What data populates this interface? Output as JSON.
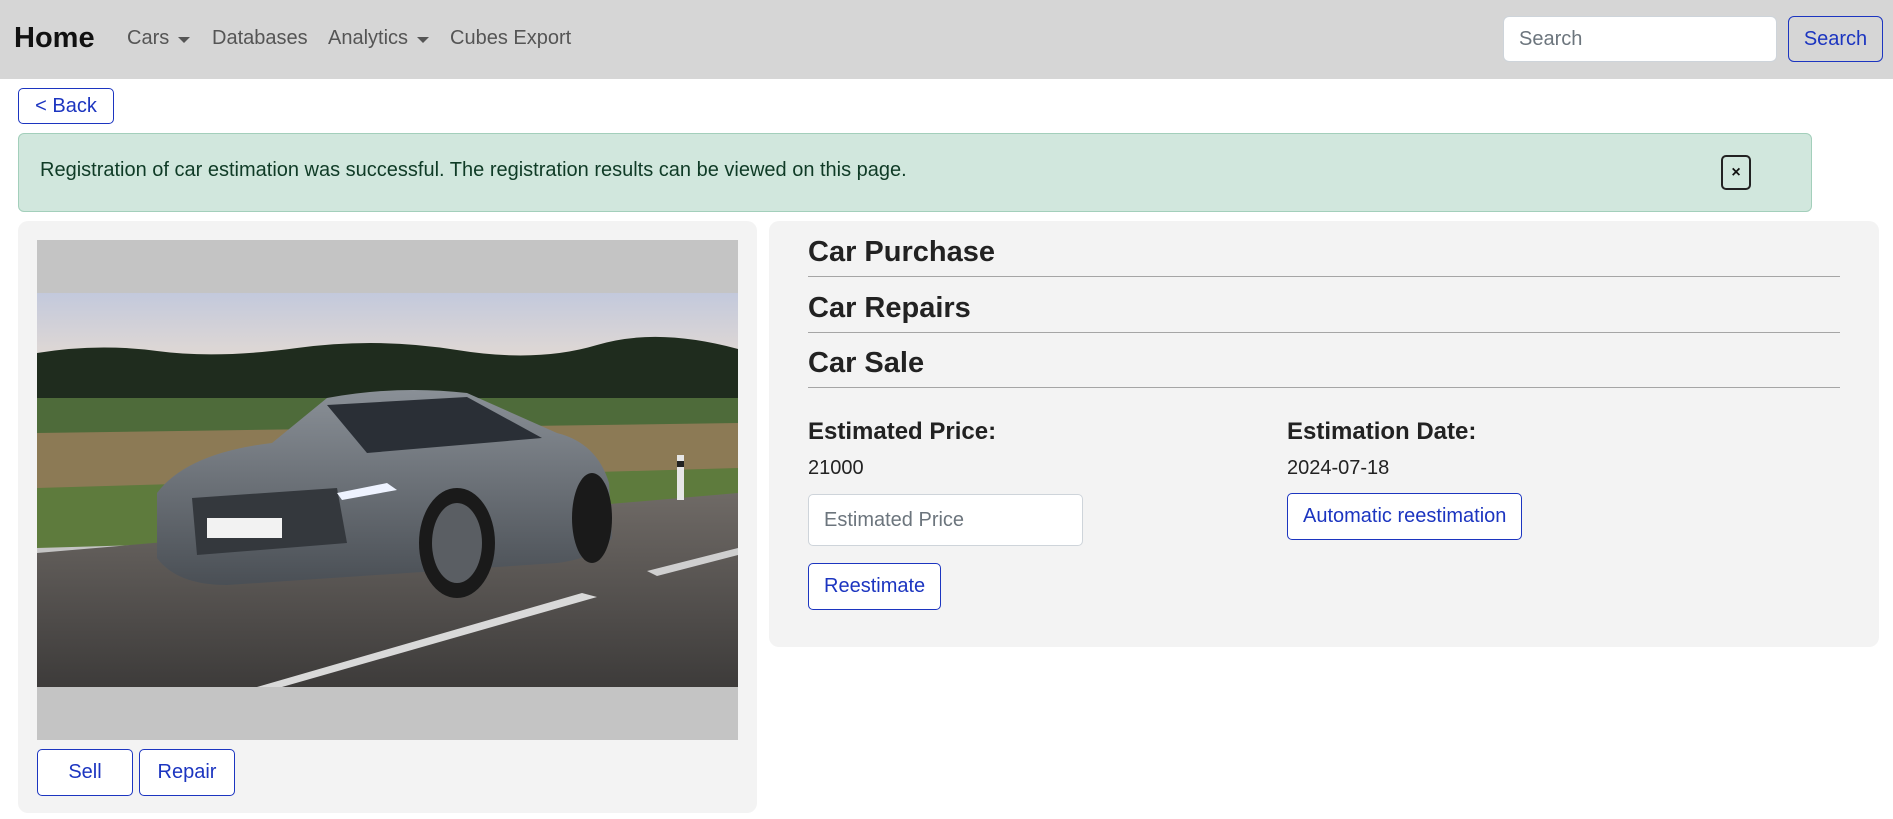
{
  "navbar": {
    "brand": "Home",
    "items": [
      {
        "label": "Cars",
        "dropdown": true
      },
      {
        "label": "Databases",
        "dropdown": false
      },
      {
        "label": "Analytics",
        "dropdown": true
      },
      {
        "label": "Cubes Export",
        "dropdown": false
      }
    ],
    "search_placeholder": "Search",
    "search_button": "Search"
  },
  "back_button": "< Back",
  "alert": {
    "message": "Registration of car estimation was successful. The registration results can be viewed on this page.",
    "close_label": "×"
  },
  "car_card": {
    "image_icon": "car-photo",
    "sell_button": "Sell",
    "repair_button": "Repair"
  },
  "details": {
    "sections": [
      "Car Purchase",
      "Car Repairs",
      "Car Sale"
    ],
    "estimated_price_label": "Estimated Price:",
    "estimated_price_value": "21000",
    "estimated_price_placeholder": "Estimated Price",
    "reestimate_button": "Reestimate",
    "estimation_date_label": "Estimation Date:",
    "estimation_date_value": "2024-07-18",
    "auto_reestimate_button": "Automatic reestimation"
  },
  "colors": {
    "accent": "#1c35c0",
    "navbar_bg": "#d6d6d6",
    "alert_bg": "#d1e7dd",
    "card_bg": "#f3f3f3"
  }
}
